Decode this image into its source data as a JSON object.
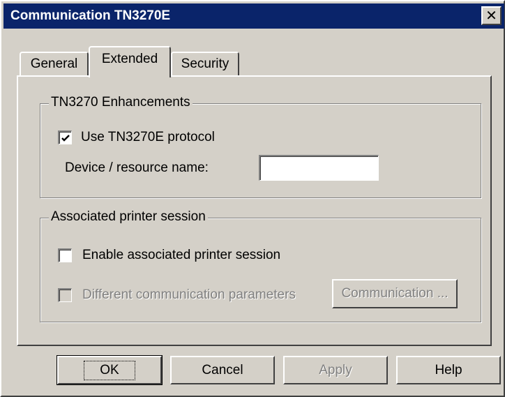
{
  "window": {
    "title": "Communication TN3270E",
    "close_glyph": "✕"
  },
  "tabs": [
    {
      "label": "General",
      "active": false
    },
    {
      "label": "Extended",
      "active": true
    },
    {
      "label": "Security",
      "active": false
    }
  ],
  "enhancements": {
    "group_label": "TN3270 Enhancements",
    "use_protocol_label": "Use TN3270E protocol",
    "use_protocol_checked": true,
    "device_label": "Device / resource name:",
    "device_value": ""
  },
  "printer": {
    "group_label": "Associated printer session",
    "enable_label": "Enable associated printer session",
    "enable_checked": false,
    "different_params_label": "Different communication parameters",
    "different_params_checked": false,
    "communication_button_label": "Communication ..."
  },
  "buttons": {
    "ok": "OK",
    "cancel": "Cancel",
    "apply": "Apply",
    "help": "Help"
  },
  "colors": {
    "titlebar": "#0a246a",
    "face": "#d4d0c8",
    "disabled_text": "#808080"
  }
}
